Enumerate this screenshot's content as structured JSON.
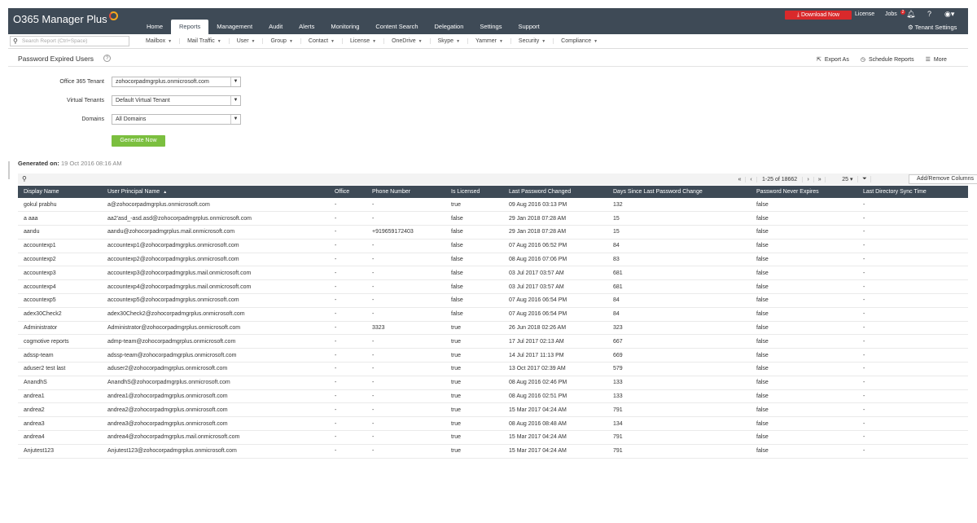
{
  "app": {
    "logo": "O365 Manager Plus"
  },
  "nav": {
    "tabs": [
      "Home",
      "Reports",
      "Management",
      "Audit",
      "Alerts",
      "Monitoring",
      "Content Search",
      "Delegation",
      "Settings",
      "Support"
    ]
  },
  "topright": {
    "download": "Download Now",
    "license": "License",
    "jobs": "Jobs",
    "jobs_badge": "2",
    "tenant_settings": "Tenant Settings"
  },
  "subnav": {
    "search_placeholder": "Search Report (Ctrl+Space)",
    "items": [
      "Mailbox",
      "Mail Traffic",
      "User",
      "Group",
      "Contact",
      "License",
      "OneDrive",
      "Skype",
      "Yammer",
      "Security",
      "Compliance"
    ]
  },
  "page": {
    "title": "Password Expired Users",
    "help": "?"
  },
  "actions": {
    "export": "Export As",
    "schedule": "Schedule Reports",
    "more": "More"
  },
  "form": {
    "tenant_label": "Office 365 Tenant",
    "tenant_value": "zohocorpadmgrplus.onmicrosoft.com",
    "vt_label": "Virtual Tenants",
    "vt_value": "Default Virtual Tenant",
    "domains_label": "Domains",
    "domains_value": "All Domains",
    "generate": "Generate Now"
  },
  "generated": {
    "label": "Generated on:",
    "value": "19 Oct 2016 08:16 AM"
  },
  "pager": {
    "info": "1-25 of 18662",
    "page_size": "25",
    "add_remove": "Add/Remove Columns"
  },
  "table": {
    "columns": [
      "Display Name",
      "User Principal Name",
      "Office",
      "Phone Number",
      "Is Licensed",
      "Last Password Changed",
      "Days Since Last Password Change",
      "Password Never Expires",
      "Last Directory Sync Time"
    ],
    "rows": [
      [
        "gokul prabhu",
        "a@zohocorpadmgrplus.onmicrosoft.com",
        "-",
        "-",
        "true",
        "09 Aug 2016 03:13 PM",
        "132",
        "false",
        "-"
      ],
      [
        "a aaa",
        "aa2'asd_-asd.asd@zohocorpadmgrplus.onmicrosoft.com",
        "-",
        "-",
        "false",
        "29 Jan 2018 07:28 AM",
        "15",
        "false",
        "-"
      ],
      [
        "aandu",
        "aandu@zohocorpadmgrplus.mail.onmicrosoft.com",
        "-",
        "+919659172403",
        "false",
        "29 Jan 2018 07:28 AM",
        "15",
        "false",
        "-"
      ],
      [
        "accountexp1",
        "accountexp1@zohocorpadmgrplus.onmicrosoft.com",
        "-",
        "-",
        "false",
        "07 Aug 2016 06:52 PM",
        "84",
        "false",
        "-"
      ],
      [
        "accountexp2",
        "accountexp2@zohocorpadmgrplus.onmicrosoft.com",
        "-",
        "-",
        "false",
        "08 Aug 2016 07:06 PM",
        "83",
        "false",
        "-"
      ],
      [
        "accountexp3",
        "accountexp3@zohocorpadmgrplus.mail.onmicrosoft.com",
        "-",
        "-",
        "false",
        "03 Jul 2017 03:57 AM",
        "681",
        "false",
        "-"
      ],
      [
        "accountexp4",
        "accountexp4@zohocorpadmgrplus.mail.onmicrosoft.com",
        "-",
        "-",
        "false",
        "03 Jul 2017 03:57 AM",
        "681",
        "false",
        "-"
      ],
      [
        "accountexp5",
        "accountexp5@zohocorpadmgrplus.onmicrosoft.com",
        "-",
        "-",
        "false",
        "07 Aug 2016 06:54 PM",
        "84",
        "false",
        "-"
      ],
      [
        "adex30Check2",
        "adex30Check2@zohocorpadmgrplus.onmicrosoft.com",
        "-",
        "-",
        "false",
        "07 Aug 2016 06:54 PM",
        "84",
        "false",
        "-"
      ],
      [
        "Administrator",
        "Administrator@zohocorpadmgrplus.onmicrosoft.com",
        "-",
        "3323",
        "true",
        "26 Jun 2018 02:26 AM",
        "323",
        "false",
        "-"
      ],
      [
        "cogmotive reports",
        "admp-team@zohocorpadmgrplus.onmicrosoft.com",
        "-",
        "-",
        "true",
        "17 Jul 2017 02:13 AM",
        "667",
        "false",
        "-"
      ],
      [
        "adssp-team",
        "adssp-team@zohocorpadmgrplus.onmicrosoft.com",
        "-",
        "-",
        "true",
        "14 Jul 2017 11:13 PM",
        "669",
        "false",
        "-"
      ],
      [
        "aduser2 test last",
        "aduser2@zohocorpadmgrplus.onmicrosoft.com",
        "-",
        "-",
        "true",
        "13 Oct 2017 02:39 AM",
        "579",
        "false",
        "-"
      ],
      [
        "AnandhS",
        "AnandhS@zohocorpadmgrplus.onmicrosoft.com",
        "-",
        "-",
        "true",
        "08 Aug 2016 02:46 PM",
        "133",
        "false",
        "-"
      ],
      [
        "andrea1",
        "andrea1@zohocorpadmgrplus.onmicrosoft.com",
        "-",
        "-",
        "true",
        "08 Aug 2016 02:51 PM",
        "133",
        "false",
        "-"
      ],
      [
        "andrea2",
        "andrea2@zohocorpadmgrplus.onmicrosoft.com",
        "-",
        "-",
        "true",
        "15 Mar 2017 04:24 AM",
        "791",
        "false",
        "-"
      ],
      [
        "andrea3",
        "andrea3@zohocorpadmgrplus.onmicrosoft.com",
        "-",
        "-",
        "true",
        "08 Aug 2016 08:48 AM",
        "134",
        "false",
        "-"
      ],
      [
        "andrea4",
        "andrea4@zohocorpadmgrplus.mail.onmicrosoft.com",
        "-",
        "-",
        "true",
        "15 Mar 2017 04:24 AM",
        "791",
        "false",
        "-"
      ],
      [
        "Anjutest123",
        "Anjutest123@zohocorpadmgrplus.onmicrosoft.com",
        "-",
        "-",
        "true",
        "15 Mar 2017 04:24 AM",
        "791",
        "false",
        "-"
      ]
    ]
  }
}
